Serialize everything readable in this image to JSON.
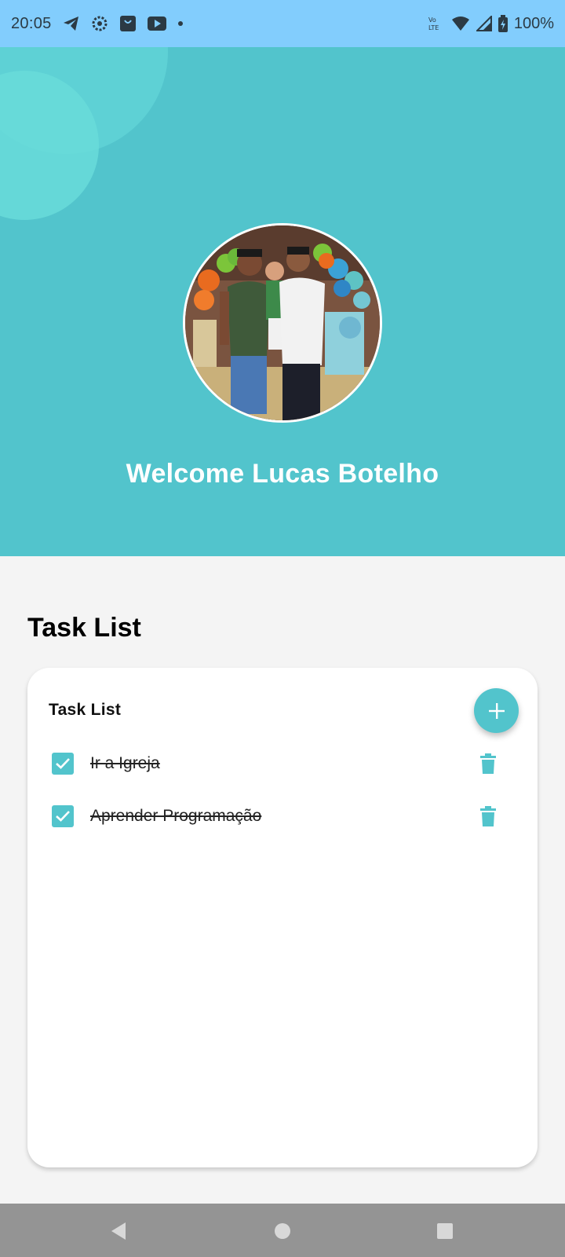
{
  "status_bar": {
    "time": "20:05",
    "left_icons": [
      "telegram-icon",
      "settings-icon",
      "shopping-bag-icon",
      "youtube-icon",
      "dot-icon"
    ],
    "network_label": "Vo LTE",
    "battery": "100%"
  },
  "header": {
    "welcome_text": "Welcome Lucas Botelho",
    "colors": {
      "background": "#52c4cc",
      "accent": "#52c4cc"
    }
  },
  "main": {
    "section_title": "Task List",
    "card": {
      "title": "Task List",
      "add_icon": "plus-icon",
      "tasks": [
        {
          "label": "Ir a Igreja",
          "checked": true
        },
        {
          "label": "Aprender Programação ",
          "checked": true
        }
      ]
    }
  },
  "nav_bar": {
    "buttons": [
      "back-icon",
      "home-icon",
      "recents-icon"
    ]
  }
}
